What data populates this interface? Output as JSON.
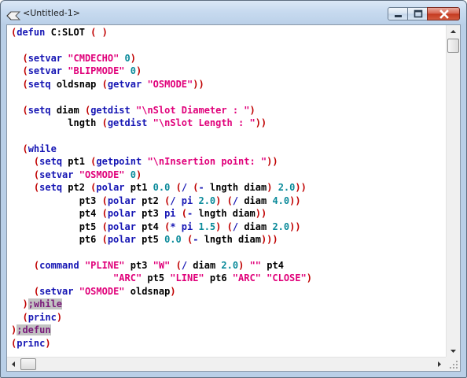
{
  "window": {
    "title": "<Untitled-1>"
  },
  "colors": {
    "keyword": "#1616b4",
    "paren": "#c00000",
    "string": "#e0007a",
    "number": "#0a8a9a",
    "symbol": "#000000",
    "comment": "#7a1a7a",
    "comment_highlight": "#c2c2c2"
  },
  "icons": {
    "app": "lisp-file-icon",
    "minimize": "minimize-icon",
    "maximize": "maximize-icon",
    "close": "close-icon",
    "scroll_up": "arrow-up-icon",
    "scroll_down": "arrow-down-icon",
    "scroll_left": "arrow-left-icon",
    "scroll_right": "arrow-right-icon",
    "resize": "resize-grip-icon"
  },
  "editor": {
    "lines": [
      [
        [
          "p",
          "("
        ],
        [
          "k",
          "defun"
        ],
        [
          "s",
          " C:SLOT "
        ],
        [
          "p",
          "("
        ],
        [
          "s",
          " "
        ],
        [
          "p",
          ")"
        ]
      ],
      [],
      [
        [
          "s",
          "  "
        ],
        [
          "p",
          "("
        ],
        [
          "k",
          "setvar"
        ],
        [
          "s",
          " "
        ],
        [
          "t",
          "\"CMDECHO\""
        ],
        [
          "s",
          " "
        ],
        [
          "n",
          "0"
        ],
        [
          "p",
          ")"
        ]
      ],
      [
        [
          "s",
          "  "
        ],
        [
          "p",
          "("
        ],
        [
          "k",
          "setvar"
        ],
        [
          "s",
          " "
        ],
        [
          "t",
          "\"BLIPMODE\""
        ],
        [
          "s",
          " "
        ],
        [
          "n",
          "0"
        ],
        [
          "p",
          ")"
        ]
      ],
      [
        [
          "s",
          "  "
        ],
        [
          "p",
          "("
        ],
        [
          "k",
          "setq"
        ],
        [
          "s",
          " oldsnap "
        ],
        [
          "p",
          "("
        ],
        [
          "k",
          "getvar"
        ],
        [
          "s",
          " "
        ],
        [
          "t",
          "\"OSMODE\""
        ],
        [
          "p",
          "))"
        ]
      ],
      [],
      [
        [
          "s",
          "  "
        ],
        [
          "p",
          "("
        ],
        [
          "k",
          "setq"
        ],
        [
          "s",
          " diam "
        ],
        [
          "p",
          "("
        ],
        [
          "k",
          "getdist"
        ],
        [
          "s",
          " "
        ],
        [
          "t",
          "\"\\nSlot Diameter : \""
        ],
        [
          "p",
          ")"
        ]
      ],
      [
        [
          "s",
          "          lngth "
        ],
        [
          "p",
          "("
        ],
        [
          "k",
          "getdist"
        ],
        [
          "s",
          " "
        ],
        [
          "t",
          "\"\\nSlot Length : \""
        ],
        [
          "p",
          "))"
        ]
      ],
      [],
      [
        [
          "s",
          "  "
        ],
        [
          "p",
          "("
        ],
        [
          "k",
          "while"
        ]
      ],
      [
        [
          "s",
          "    "
        ],
        [
          "p",
          "("
        ],
        [
          "k",
          "setq"
        ],
        [
          "s",
          " pt1 "
        ],
        [
          "p",
          "("
        ],
        [
          "k",
          "getpoint"
        ],
        [
          "s",
          " "
        ],
        [
          "t",
          "\"\\nInsertion point: \""
        ],
        [
          "p",
          "))"
        ]
      ],
      [
        [
          "s",
          "    "
        ],
        [
          "p",
          "("
        ],
        [
          "k",
          "setvar"
        ],
        [
          "s",
          " "
        ],
        [
          "t",
          "\"OSMODE\""
        ],
        [
          "s",
          " "
        ],
        [
          "n",
          "0"
        ],
        [
          "p",
          ")"
        ]
      ],
      [
        [
          "s",
          "    "
        ],
        [
          "p",
          "("
        ],
        [
          "k",
          "setq"
        ],
        [
          "s",
          " pt2 "
        ],
        [
          "p",
          "("
        ],
        [
          "k",
          "polar"
        ],
        [
          "s",
          " pt1 "
        ],
        [
          "n",
          "0.0"
        ],
        [
          "s",
          " "
        ],
        [
          "p",
          "("
        ],
        [
          "k",
          "/"
        ],
        [
          "s",
          " "
        ],
        [
          "p",
          "("
        ],
        [
          "k",
          "-"
        ],
        [
          "s",
          " lngth diam"
        ],
        [
          "p",
          ")"
        ],
        [
          "s",
          " "
        ],
        [
          "n",
          "2.0"
        ],
        [
          "p",
          "))"
        ]
      ],
      [
        [
          "s",
          "            pt3 "
        ],
        [
          "p",
          "("
        ],
        [
          "k",
          "polar"
        ],
        [
          "s",
          " pt2 "
        ],
        [
          "p",
          "("
        ],
        [
          "k",
          "/"
        ],
        [
          "s",
          " "
        ],
        [
          "k",
          "pi"
        ],
        [
          "s",
          " "
        ],
        [
          "n",
          "2.0"
        ],
        [
          "p",
          ")"
        ],
        [
          "s",
          " "
        ],
        [
          "p",
          "("
        ],
        [
          "k",
          "/"
        ],
        [
          "s",
          " diam "
        ],
        [
          "n",
          "4.0"
        ],
        [
          "p",
          "))"
        ]
      ],
      [
        [
          "s",
          "            pt4 "
        ],
        [
          "p",
          "("
        ],
        [
          "k",
          "polar"
        ],
        [
          "s",
          " pt3 "
        ],
        [
          "k",
          "pi"
        ],
        [
          "s",
          " "
        ],
        [
          "p",
          "("
        ],
        [
          "k",
          "-"
        ],
        [
          "s",
          " lngth diam"
        ],
        [
          "p",
          "))"
        ]
      ],
      [
        [
          "s",
          "            pt5 "
        ],
        [
          "p",
          "("
        ],
        [
          "k",
          "polar"
        ],
        [
          "s",
          " pt4 "
        ],
        [
          "p",
          "("
        ],
        [
          "k",
          "*"
        ],
        [
          "s",
          " "
        ],
        [
          "k",
          "pi"
        ],
        [
          "s",
          " "
        ],
        [
          "n",
          "1.5"
        ],
        [
          "p",
          ")"
        ],
        [
          "s",
          " "
        ],
        [
          "p",
          "("
        ],
        [
          "k",
          "/"
        ],
        [
          "s",
          " diam "
        ],
        [
          "n",
          "2.0"
        ],
        [
          "p",
          "))"
        ]
      ],
      [
        [
          "s",
          "            pt6 "
        ],
        [
          "p",
          "("
        ],
        [
          "k",
          "polar"
        ],
        [
          "s",
          " pt5 "
        ],
        [
          "n",
          "0.0"
        ],
        [
          "s",
          " "
        ],
        [
          "p",
          "("
        ],
        [
          "k",
          "-"
        ],
        [
          "s",
          " lngth diam"
        ],
        [
          "p",
          ")))"
        ]
      ],
      [],
      [
        [
          "s",
          "    "
        ],
        [
          "p",
          "("
        ],
        [
          "k",
          "command"
        ],
        [
          "s",
          " "
        ],
        [
          "t",
          "\"PLINE\""
        ],
        [
          "s",
          " pt3 "
        ],
        [
          "t",
          "\"W\""
        ],
        [
          "s",
          " "
        ],
        [
          "p",
          "("
        ],
        [
          "k",
          "/"
        ],
        [
          "s",
          " diam "
        ],
        [
          "n",
          "2.0"
        ],
        [
          "p",
          ")"
        ],
        [
          "s",
          " "
        ],
        [
          "t",
          "\"\""
        ],
        [
          "s",
          " pt4"
        ]
      ],
      [
        [
          "s",
          "                  "
        ],
        [
          "t",
          "\"ARC\""
        ],
        [
          "s",
          " pt5 "
        ],
        [
          "t",
          "\"LINE\""
        ],
        [
          "s",
          " pt6 "
        ],
        [
          "t",
          "\"ARC\""
        ],
        [
          "s",
          " "
        ],
        [
          "t",
          "\"CLOSE\""
        ],
        [
          "p",
          ")"
        ]
      ],
      [
        [
          "s",
          "    "
        ],
        [
          "p",
          "("
        ],
        [
          "k",
          "setvar"
        ],
        [
          "s",
          " "
        ],
        [
          "t",
          "\"OSMODE\""
        ],
        [
          "s",
          " oldsnap"
        ],
        [
          "p",
          ")"
        ]
      ],
      [
        [
          "s",
          "  "
        ],
        [
          "p",
          ")"
        ],
        [
          "c",
          ";while"
        ]
      ],
      [
        [
          "s",
          "  "
        ],
        [
          "p",
          "("
        ],
        [
          "k",
          "princ"
        ],
        [
          "p",
          ")"
        ]
      ],
      [
        [
          "p",
          ")"
        ],
        [
          "c",
          ";defun"
        ]
      ],
      [
        [
          "p",
          "("
        ],
        [
          "k",
          "princ"
        ],
        [
          "p",
          ")"
        ]
      ]
    ]
  }
}
